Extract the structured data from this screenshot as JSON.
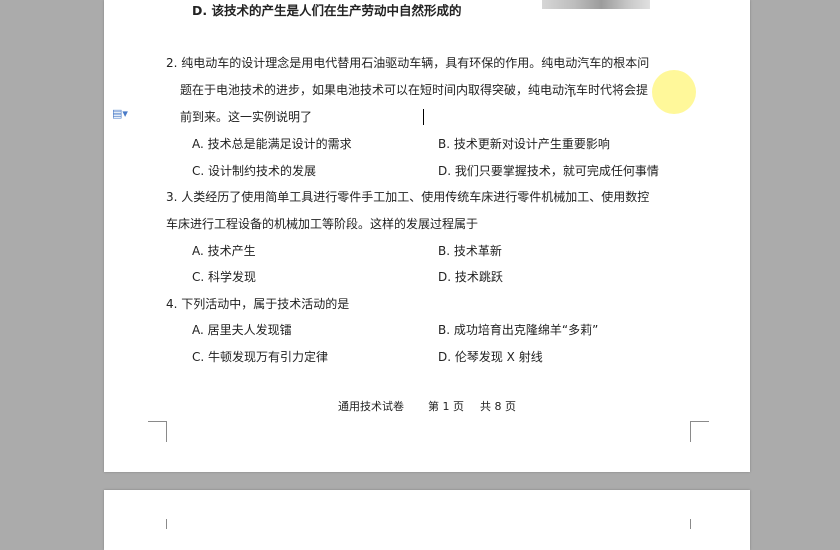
{
  "doc": {
    "prev_option_d": "D. 该技术的产生是人们在生产劳动中自然形成的",
    "q2": {
      "line1": "2.  纯电动车的设计理念是用电代替用石油驱动车辆，具有环保的作用。纯电动汽车的根本问",
      "line2": "题在于电池技术的进步，如果电池技术可以在短时间内取得突破，纯电动汽车时代将会提",
      "line3": "前到来。这一实例说明了",
      "options": {
        "a": "A.  技术总是能满足设计的需求",
        "b": "B.  技术更新对设计产生重要影响",
        "c": "C.  设计制约技术的发展",
        "d": "D.  我们只要掌握技术，就可完成任何事情"
      }
    },
    "q3": {
      "line1": "3.  人类经历了使用简单工具进行零件手工加工、使用传统车床进行零件机械加工、使用数控",
      "line2": "车床进行工程设备的机械加工等阶段。这样的发展过程属于",
      "options": {
        "a": "A.  技术产生",
        "b": "B.  技术革新",
        "c": "C.  科学发现",
        "d": "D.  技术跳跃"
      }
    },
    "q4": {
      "line1": "4.  下列活动中，属于技术活动的是",
      "options": {
        "a": "A.  居里夫人发现镭",
        "b": "B.  成功培育出克隆绵羊“多莉”",
        "c": "C.  牛顿发现万有引力定律",
        "d": "D.  伦琴发现 X 射线"
      }
    },
    "footer": {
      "subject": "通用技术试卷",
      "page": "第 1 页",
      "total": "共 8 页"
    }
  },
  "ui": {
    "margin_icon": "document-options-icon",
    "cursor_icon": "text-ibeam-cursor-icon",
    "highlight_color": "#fff678"
  }
}
